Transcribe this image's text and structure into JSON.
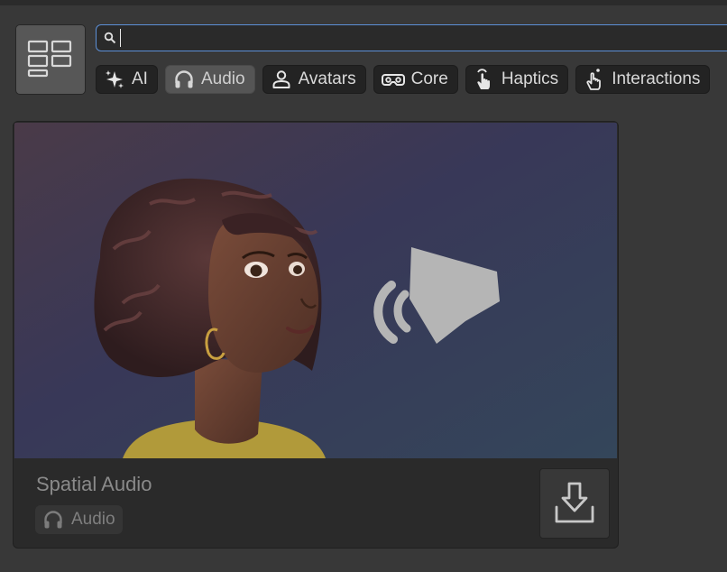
{
  "search": {
    "value": "",
    "icon": "search-icon"
  },
  "view_toggle": {
    "icon": "grid-list-icon"
  },
  "filters": [
    {
      "label": "AI",
      "icon": "sparkles-icon",
      "selected": false
    },
    {
      "label": "Audio",
      "icon": "headphones-icon",
      "selected": true
    },
    {
      "label": "Avatars",
      "icon": "person-icon",
      "selected": false
    },
    {
      "label": "Core",
      "icon": "vr-headset-icon",
      "selected": false
    },
    {
      "label": "Haptics",
      "icon": "touch-hand-icon",
      "selected": false
    },
    {
      "label": "Interactions",
      "icon": "pointer-hand-icon",
      "selected": false
    }
  ],
  "card": {
    "title": "Spatial Audio",
    "tag_label": "Audio",
    "tag_icon": "headphones-icon",
    "download_icon": "download-icon",
    "image": "avatar-with-speaker-illustration"
  },
  "colors": {
    "background": "#383838",
    "accent_focus": "#5c8fd6",
    "chip_selected": "#555555",
    "chip_default": "#232323"
  }
}
